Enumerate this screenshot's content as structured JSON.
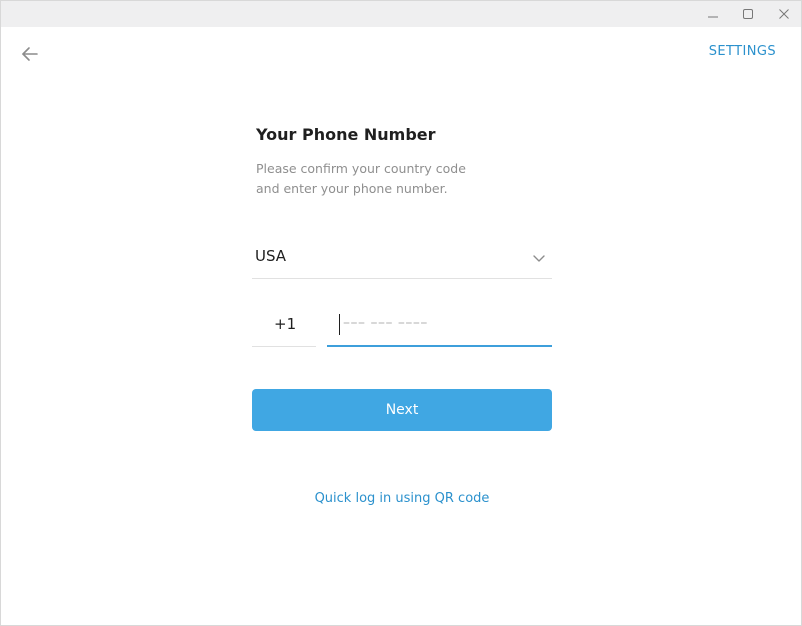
{
  "window_controls": {
    "minimize": "minimize-icon",
    "maximize": "maximize-icon",
    "close": "close-icon"
  },
  "header": {
    "back_icon": "arrow-left-icon",
    "settings_label": "SETTINGS"
  },
  "login": {
    "title": "Your Phone Number",
    "subtitle_line1": "Please confirm your country code",
    "subtitle_line2": "and enter your phone number.",
    "country": "USA",
    "country_chevron_icon": "chevron-down-icon",
    "country_code": "+1",
    "phone_value": "",
    "phone_placeholder": "––– ––– ––––",
    "next_label": "Next",
    "qr_link": "Quick log in using QR code"
  },
  "colors": {
    "accent": "#40a7e3",
    "link": "#2b91cd",
    "focus_underline": "#3d9fdb"
  }
}
